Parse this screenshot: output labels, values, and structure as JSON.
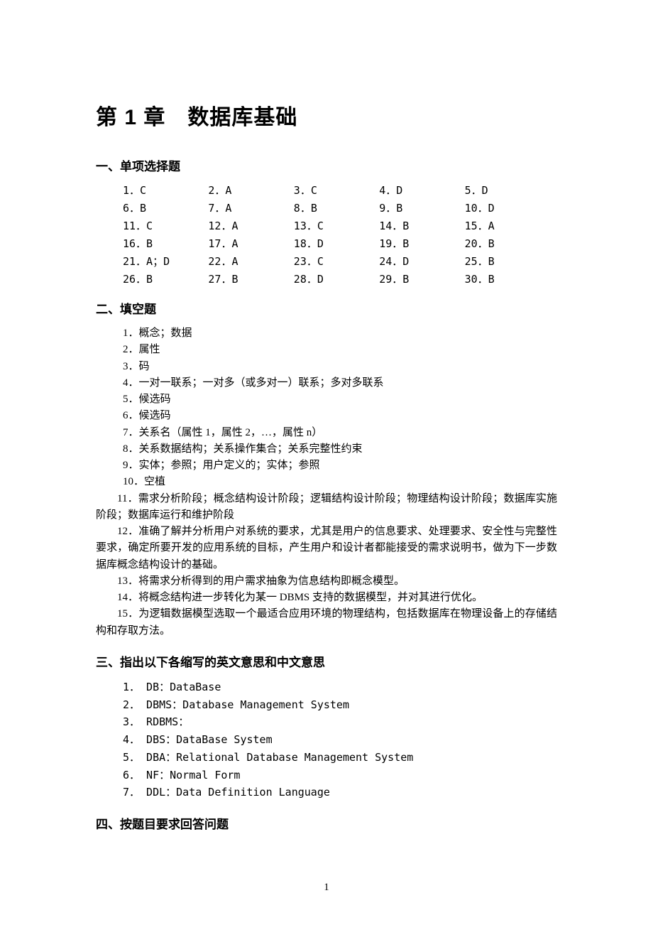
{
  "chapter_title": "第 1 章　数据库基础",
  "section1": {
    "title": "一、单项选择题",
    "answers": [
      "1．C",
      "2．A",
      "3．C",
      "4．D",
      "5．D",
      "6．B",
      "7．A",
      "8．B",
      "9．B",
      "10．D",
      "11．C",
      "12．A",
      "13．C",
      "14．B",
      "15．A",
      "16．B",
      "17．A",
      "18．D",
      "19．B",
      "20．B",
      "21．A；D",
      "22．A",
      "23．C",
      "24．D",
      "25．B",
      "26．B",
      "27．B",
      "28．D",
      "29．B",
      "30．B"
    ]
  },
  "section2": {
    "title": "二、填空题",
    "items": [
      "1．概念；数据",
      "2．属性",
      "3．码",
      "4．一对一联系；一对多（或多对一）联系；多对多联系",
      "5．候选码",
      "6．候选码",
      "7．关系名（属性 1，属性 2，…，属性 n）",
      "8．关系数据结构；关系操作集合；关系完整性约束",
      "9．实体；参照；用户定义的；实体；参照",
      "10．空植"
    ],
    "paragraphs": [
      "11．需求分析阶段；概念结构设计阶段；逻辑结构设计阶段；物理结构设计阶段；数据库实施阶段；数据库运行和维护阶段",
      "12．准确了解并分析用户对系统的要求，尤其是用户的信息要求、处理要求、安全性与完整性要求，确定所要开发的应用系统的目标，产生用户和设计者都能接受的需求说明书，做为下一步数据库概念结构设计的基础。",
      "13．将需求分析得到的用户需求抽象为信息结构即概念模型。",
      "14．将概念结构进一步转化为某一 DBMS 支持的数据模型，并对其进行优化。",
      "15．为逻辑数据模型选取一个最适合应用环境的物理结构，包括数据库在物理设备上的存储结构和存取方法。"
    ]
  },
  "section3": {
    "title": "三、指出以下各缩写的英文意思和中文意思",
    "items": [
      "1． DB：DataBase",
      "2． DBMS：Database Management System",
      "3． RDBMS：",
      "4． DBS：DataBase System",
      "5． DBA：Relational Database Management System",
      "6． NF：Normal Form",
      "7． DDL：Data Definition Language"
    ]
  },
  "section4": {
    "title": "四、按题目要求回答问题"
  },
  "page_number": "1"
}
